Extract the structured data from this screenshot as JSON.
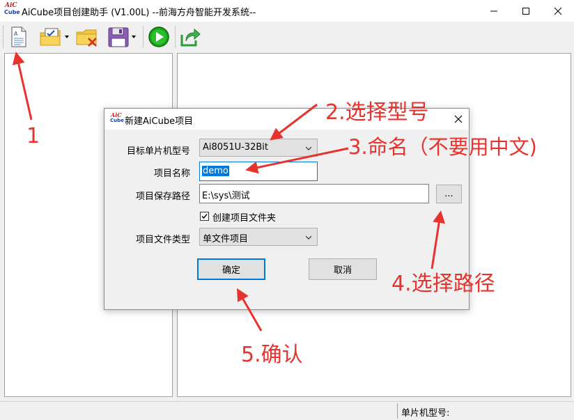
{
  "window": {
    "title": "AiCube项目创建助手 (V1.00L) --前海方舟智能开发系统--",
    "logo_text_top": "AiC",
    "logo_text_bottom": "Cube"
  },
  "toolbar": {
    "buttons": [
      "new-document-icon",
      "checklist-folder-icon",
      "delete-folder-icon",
      "save-icon",
      "run-icon",
      "export-icon"
    ]
  },
  "statusbar": {
    "mcu_label": "单片机型号:"
  },
  "dialog": {
    "title": "新建AiCube项目",
    "mcu_label": "目标单片机型号",
    "mcu_value": "Ai8051U-32Bit",
    "name_label": "项目名称",
    "name_value": "demo",
    "path_label": "项目保存路径",
    "path_value": "E:\\sys\\测试",
    "browse_label": "...",
    "create_folder_label": "创建项目文件夹",
    "create_folder_checked": true,
    "type_label": "项目文件类型",
    "type_value": "单文件项目",
    "ok_label": "确定",
    "cancel_label": "取消"
  },
  "annotations": {
    "step1": "1",
    "step2": "2.选择型号",
    "step3": "3.命名（不要用中文)",
    "step4": "4.选择路径",
    "step5": "5.确认"
  },
  "colors": {
    "annotation": "#e8322d",
    "accent": "#0078d7",
    "run_green": "#1aa31a"
  }
}
